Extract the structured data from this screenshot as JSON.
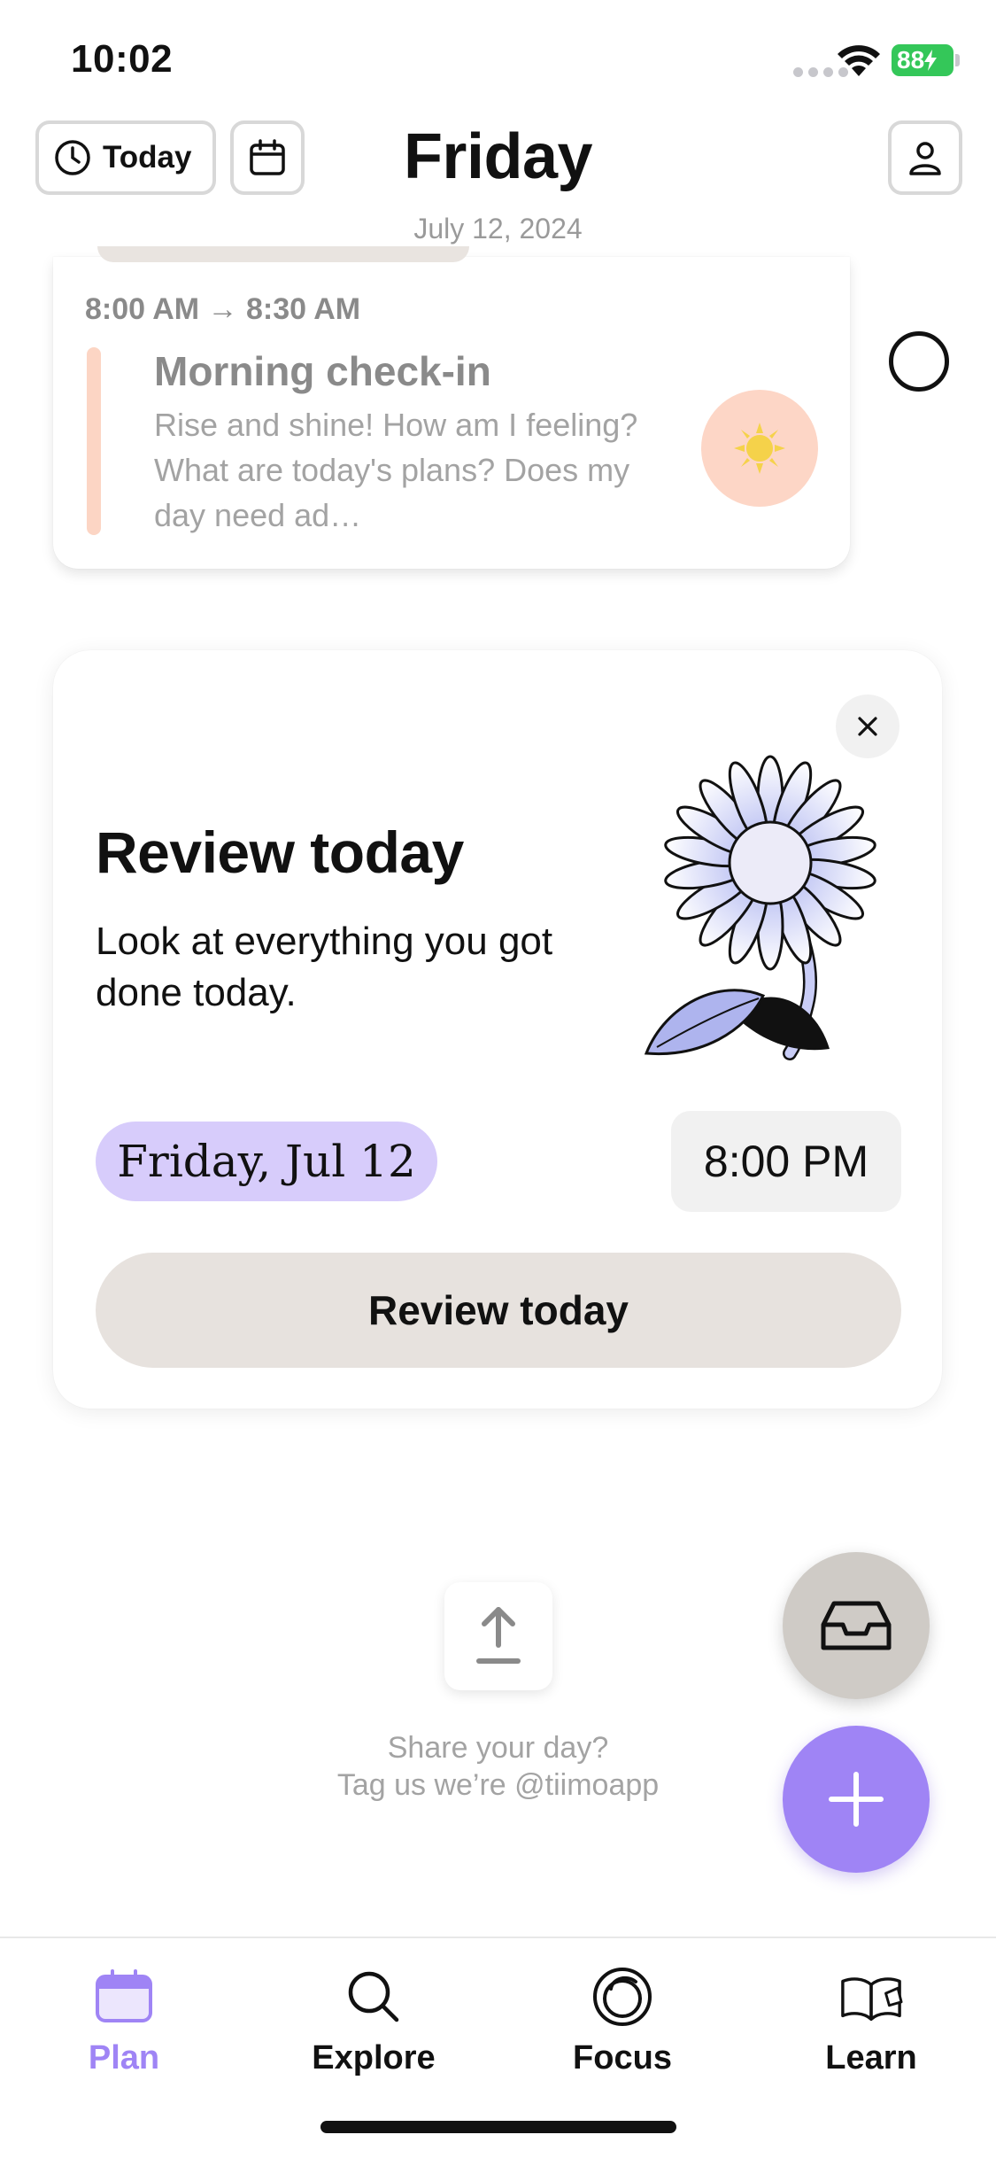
{
  "status_bar": {
    "time": "10:02",
    "battery": "88"
  },
  "header": {
    "today_label": "Today",
    "title": "Friday",
    "subtitle": "July 12, 2024"
  },
  "task": {
    "time": "8:00 AM → 8:30 AM",
    "title": "Morning check-in",
    "description": "Rise and shine! How am I feeling? What are today's plans? Does my day need ad…",
    "accent_color": "#fcd5c4"
  },
  "review_card": {
    "title": "Review today",
    "description": "Look at everything you got done today.",
    "date": "Friday, Jul 12",
    "time": "8:00 PM",
    "button_label": "Review today"
  },
  "share": {
    "line1": "Share your day?",
    "line2": "Tag us we’re @tiimoapp"
  },
  "tabs": [
    {
      "label": "Plan",
      "icon": "calendar-icon",
      "active": true
    },
    {
      "label": "Explore",
      "icon": "search-icon",
      "active": false
    },
    {
      "label": "Focus",
      "icon": "focus-icon",
      "active": false
    },
    {
      "label": "Learn",
      "icon": "book-icon",
      "active": false
    }
  ],
  "colors": {
    "accent": "#9f84f5",
    "date_pill": "#d7ccfb",
    "battery": "#34c759"
  }
}
